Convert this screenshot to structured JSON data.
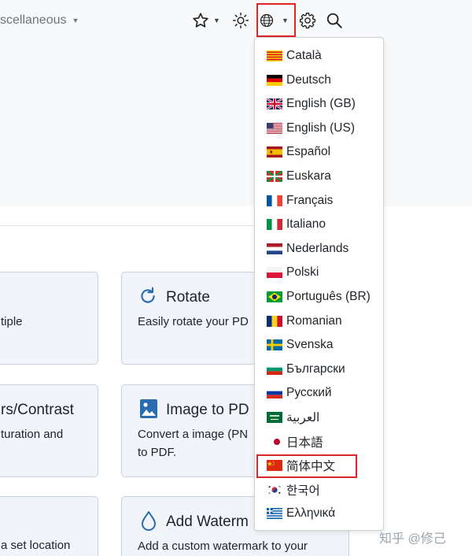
{
  "header": {
    "nav_misc_label": "scellaneous"
  },
  "cards": [
    {
      "title": "",
      "desc1": "tiple",
      "desc2": ""
    },
    {
      "title": "Rotate",
      "desc1": "Easily rotate your PD",
      "desc2": ""
    },
    {
      "title": "rs/Contrast",
      "desc1": "turation and",
      "desc2": ""
    },
    {
      "title": "Image to PD",
      "desc1": "Convert a image (PN",
      "desc2": "to PDF."
    },
    {
      "title": "",
      "desc1": "a set location",
      "desc2": ""
    },
    {
      "title": "Add Waterm",
      "desc1": "Add a custom watermark to your",
      "desc2": ""
    }
  ],
  "languages": [
    {
      "label": "Català",
      "flag": "catalonia"
    },
    {
      "label": "Deutsch",
      "flag": "germany"
    },
    {
      "label": "English (GB)",
      "flag": "uk"
    },
    {
      "label": "English (US)",
      "flag": "usa"
    },
    {
      "label": "Español",
      "flag": "spain"
    },
    {
      "label": "Euskara",
      "flag": "basque"
    },
    {
      "label": "Français",
      "flag": "france"
    },
    {
      "label": "Italiano",
      "flag": "italy"
    },
    {
      "label": "Nederlands",
      "flag": "netherlands"
    },
    {
      "label": "Polski",
      "flag": "poland"
    },
    {
      "label": "Português (BR)",
      "flag": "brazil"
    },
    {
      "label": "Romanian",
      "flag": "romania"
    },
    {
      "label": "Svenska",
      "flag": "sweden"
    },
    {
      "label": "Български",
      "flag": "bulgaria"
    },
    {
      "label": "Русский",
      "flag": "russia"
    },
    {
      "label": "العربية",
      "flag": "saudi-arabia"
    },
    {
      "label": "日本語",
      "flag": "japan"
    },
    {
      "label": "简体中文",
      "flag": "china"
    },
    {
      "label": "한국어",
      "flag": "korea"
    },
    {
      "label": "Ελληνικά",
      "flag": "greece"
    }
  ],
  "watermark": "知乎 @修己",
  "colors": {
    "highlight": "#e0242b",
    "card_bg": "#f1f5fa",
    "header_bg": "#f8f9fa"
  }
}
